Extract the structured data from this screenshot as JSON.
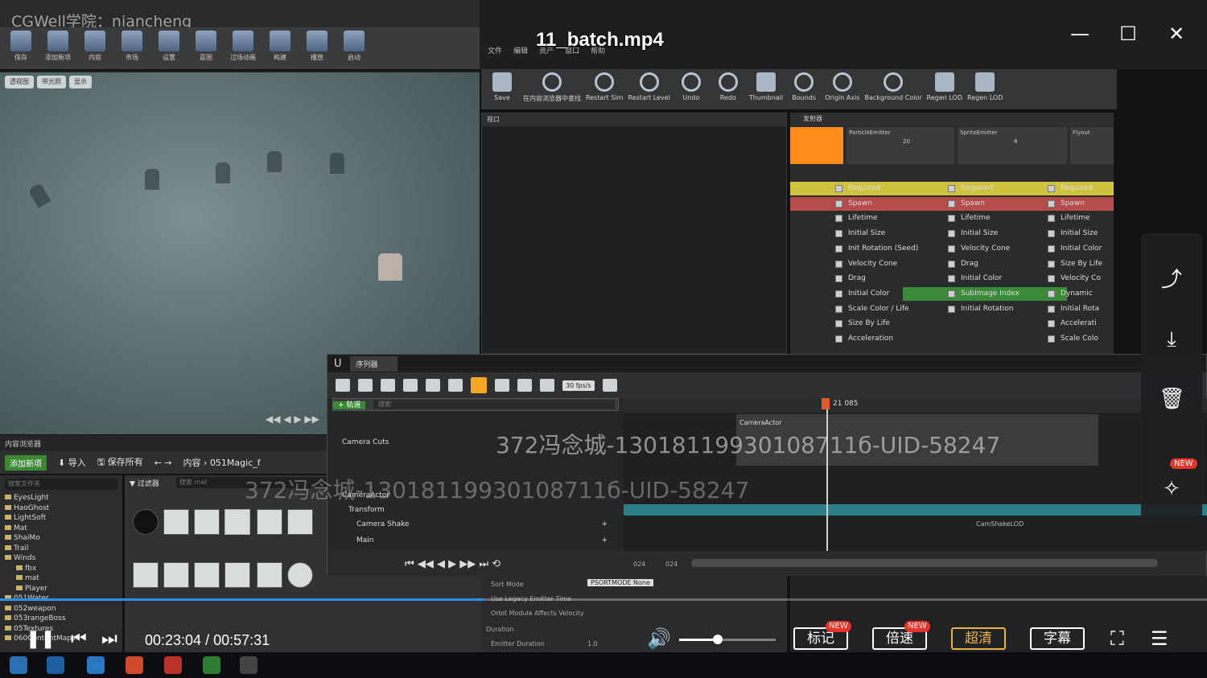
{
  "player": {
    "title": "11_batch.mp4",
    "brand_watermark": "CGWell学院：niancheng",
    "user_watermark": "372冯念城-13018119930108711б-UID-58247",
    "user_watermark_2": "372冯念城-13018119930108711б-UID-58247",
    "current_time": "00:23:04",
    "total_time": "00:57:31",
    "time_separator": " / ",
    "progress_fraction": 0.401,
    "volume_fraction": 0.4,
    "buttons": {
      "mark": "标记",
      "speed": "倍速",
      "quality": "超清",
      "subtitle": "字幕"
    },
    "badge_new": "NEW",
    "window_minimize": "—",
    "window_maximize": "☐",
    "window_close": "✕",
    "colors": {
      "accent": "#2e8fe6",
      "badge": "#e8332b",
      "quality": "#e8b34a"
    }
  },
  "ue_left": {
    "toolbar": [
      "保存",
      "添加新项",
      "内容",
      "市场",
      "设置",
      "蓝图",
      "过场动画",
      "构建",
      "播放",
      "启动"
    ],
    "viewport_chips": [
      "透视图",
      "带光照",
      "显示"
    ],
    "content_browser": {
      "tab": "内容浏览器",
      "add_new": "添加新项",
      "import": "导入",
      "save_all": "保存所有",
      "path_root": "内容",
      "path_folder": "051Magic_f",
      "search_placeholder": "搜索文件夹",
      "filter_label": "过滤器",
      "search_assets_placeholder": "搜索 mat",
      "tree": [
        "EyesLight",
        "HaoGhost",
        "LightSoft",
        "Mat",
        "ShaiMo",
        "Trail",
        "Winds",
        "fbx",
        "mat",
        "Player",
        "051Water",
        "052weapon",
        "053rangeBoss",
        "05Textures",
        "060ContentMaps"
      ]
    }
  },
  "niagara": {
    "menu": [
      "文件",
      "编辑",
      "资产",
      "窗口",
      "帮助"
    ],
    "toolbar": [
      "Save",
      "在内容浏览器中查找",
      "Restart Sim",
      "Restart Level",
      "Undo",
      "Redo",
      "Thumbnail",
      "Bounds",
      "Origin Axis",
      "Background Color",
      "Regen LOD",
      "Regen LOD"
    ],
    "panel_viewport": "视口",
    "panel_stack": "发射器",
    "emitters": [
      {
        "name": "ParticleEmitter",
        "count": "20"
      },
      {
        "name": "SpriteEmitter",
        "count": "8"
      },
      {
        "name": "Flyout",
        "count": ""
      }
    ],
    "modules_col1": [
      "Required",
      "Spawn",
      "Lifetime",
      "Initial Size",
      "Init Rotation (Seed)",
      "Velocity Cone",
      "Drag",
      "Initial Color",
      "Scale Color / Life",
      "Size By Life",
      "Acceleration"
    ],
    "modules_col2": [
      "Required",
      "Spawn",
      "Lifetime",
      "Initial Size",
      "Velocity Cone",
      "Drag",
      "Initial Color",
      "SubImage Index",
      "Initial Rotation"
    ],
    "modules_col3": [
      "Required",
      "Spawn",
      "Lifetime",
      "Initial Size",
      "Initial Color",
      "Size By Life",
      "Velocity Co",
      "Dynamic",
      "Initial Rota",
      "Accelerati",
      "Scale Colo"
    ]
  },
  "sequencer": {
    "tab": "序列器",
    "fps": "30 fps/s",
    "add_track": "+ 轨道",
    "search_placeholder": "搜索",
    "tracks": [
      "Camera Cuts",
      "CameraActor",
      "Transform",
      "Camera Shake",
      "Main"
    ],
    "current_frame": "21 085",
    "section_label": "CameraActor",
    "shake_label": "CamShakeLOD",
    "start_frame": "024",
    "end_frame": "024"
  },
  "details": {
    "rows": [
      {
        "label": "Sort Mode",
        "value": "PSORTMODE None"
      },
      {
        "label": "Use Legacy Emitter Time",
        "value": ""
      },
      {
        "label": "Orbit Module Affects Velocity",
        "value": ""
      },
      {
        "label": "Duration",
        "value": ""
      },
      {
        "label": "Emitter Duration",
        "value": "1.0"
      }
    ]
  }
}
